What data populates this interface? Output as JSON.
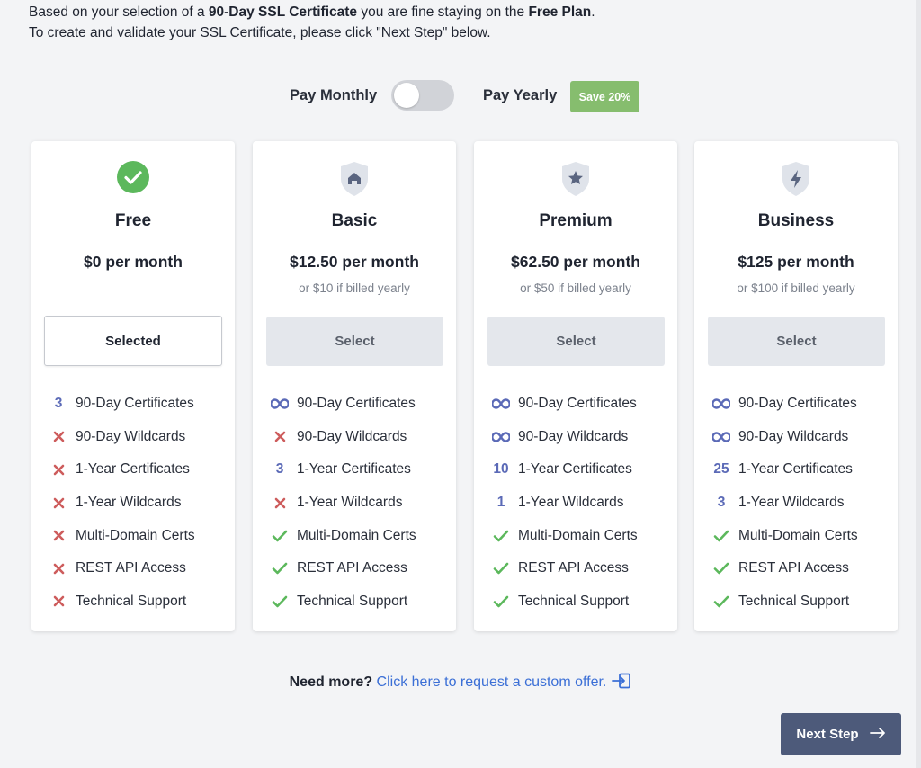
{
  "intro": {
    "p1": "Based on your selection of a ",
    "cert": "90-Day SSL Certificate",
    "p2": " you are fine staying on the ",
    "plan": "Free Plan",
    "p3": ".",
    "line2": "To create and validate your SSL Certificate, please click \"Next Step\" below."
  },
  "billing": {
    "monthly": "Pay Monthly",
    "yearly": "Pay Yearly",
    "save": "Save 20%",
    "yearly_selected": false
  },
  "features": [
    "90-Day Certificates",
    "90-Day Wildcards",
    "1-Year Certificates",
    "1-Year Wildcards",
    "Multi-Domain Certs",
    "REST API Access",
    "Technical Support"
  ],
  "plans": [
    {
      "name": "Free",
      "icon": "check-circle-icon",
      "price": "$0 per month",
      "yearly": "",
      "button": "Selected",
      "marks": [
        "3",
        "x",
        "x",
        "x",
        "x",
        "x",
        "x"
      ]
    },
    {
      "name": "Basic",
      "icon": "home-shield-icon",
      "price": "$12.50 per month",
      "yearly": "or $10 if billed yearly",
      "button": "Select",
      "marks": [
        "∞",
        "x",
        "3",
        "x",
        "check",
        "check",
        "check"
      ]
    },
    {
      "name": "Premium",
      "icon": "star-shield-icon",
      "price": "$62.50 per month",
      "yearly": "or $50 if billed yearly",
      "button": "Select",
      "marks": [
        "∞",
        "∞",
        "10",
        "1",
        "check",
        "check",
        "check"
      ]
    },
    {
      "name": "Business",
      "icon": "bolt-shield-icon",
      "price": "$125 per month",
      "yearly": "or $100 if billed yearly",
      "button": "Select",
      "marks": [
        "∞",
        "∞",
        "25",
        "3",
        "check",
        "check",
        "check"
      ]
    }
  ],
  "custom": {
    "question": "Need more?",
    "link": "Click here to request a custom offer."
  },
  "next_step": "Next Step",
  "colors": {
    "accent": "#4d5a7a",
    "success": "#5cb85c",
    "cross": "#cd5c5c",
    "number": "#5b6ab7",
    "badge": "#86bd6e",
    "link": "#3b6fd6"
  }
}
